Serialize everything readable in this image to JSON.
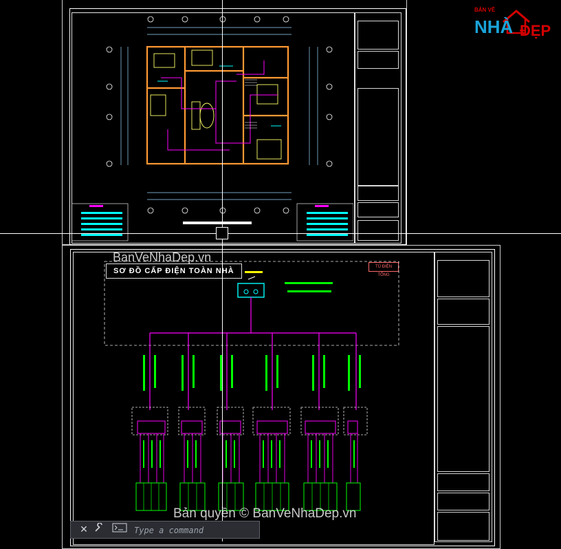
{
  "logo": {
    "top_text": "BẢN VẼ",
    "main_text": "NHÀ",
    "accent_text": "ĐẸP"
  },
  "drawing": {
    "diagram_title": "SƠ ĐỒ CẤP ĐIỆN TOÀN NHÀ",
    "panel_label": "TỦ ĐIỆN TỔNG"
  },
  "watermarks": {
    "top": "BanVeNhaDep.vn",
    "bottom": "Bản quyền © BanVeNhaDep.vn"
  },
  "command_line": {
    "placeholder": "Type a command",
    "close_icon": "close-icon",
    "settings_icon": "wrench-icon",
    "prompt_icon": "command-prompt-icon"
  },
  "colors": {
    "background": "#000000",
    "magenta": "#ff00ff",
    "cyan": "#00ffff",
    "green": "#00ff00",
    "yellow": "#ffff00",
    "red": "#ff3b3b",
    "white": "#ffffff"
  }
}
